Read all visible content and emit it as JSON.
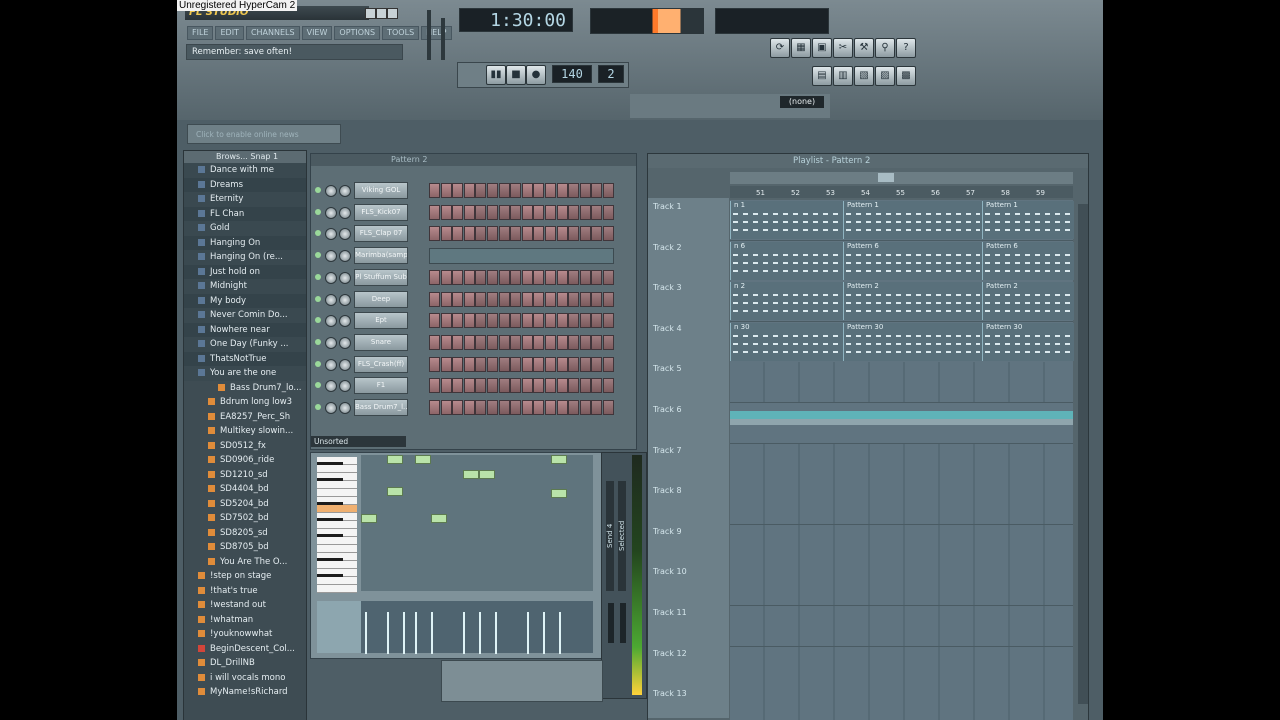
{
  "watermark": "Unregistered HyperCam 2",
  "app": {
    "logo": "FL STUDIO",
    "menu": [
      "FILE",
      "EDIT",
      "CHANNELS",
      "VIEW",
      "OPTIONS",
      "TOOLS",
      "HELP"
    ],
    "hint": "Remember: save often!",
    "time": "1:30:00",
    "tempo": "140",
    "pattern_num": "2",
    "snap_mode": "(none)",
    "online_news": "Click to enable online news"
  },
  "browser": {
    "header": "Brows... Snap 1",
    "items": [
      {
        "label": "Dance with me",
        "kind": "folder"
      },
      {
        "label": "Dreams",
        "kind": "folder"
      },
      {
        "label": "Eternity",
        "kind": "folder"
      },
      {
        "label": "FL Chan",
        "kind": "folder"
      },
      {
        "label": "Gold",
        "kind": "folder"
      },
      {
        "label": "Hanging On",
        "kind": "folder"
      },
      {
        "label": "Hanging On (re...",
        "kind": "folder"
      },
      {
        "label": "Just hold on",
        "kind": "folder"
      },
      {
        "label": "Midnight",
        "kind": "folder"
      },
      {
        "label": "My body",
        "kind": "folder"
      },
      {
        "label": "Never Comin Do...",
        "kind": "folder"
      },
      {
        "label": "Nowhere near",
        "kind": "folder"
      },
      {
        "label": "One Day (Funky ...",
        "kind": "folder"
      },
      {
        "label": "ThatsNotTrue",
        "kind": "folder"
      },
      {
        "label": "You are the one",
        "kind": "folder"
      },
      {
        "label": "Bass Drum7_lo...",
        "kind": "file-sub"
      },
      {
        "label": "Bdrum long low3",
        "kind": "file"
      },
      {
        "label": "EA8257_Perc_Sh",
        "kind": "file"
      },
      {
        "label": "Multikey slowin...",
        "kind": "file"
      },
      {
        "label": "SD0512_fx",
        "kind": "file"
      },
      {
        "label": "SD0906_ride",
        "kind": "file"
      },
      {
        "label": "SD1210_sd",
        "kind": "file"
      },
      {
        "label": "SD4404_bd",
        "kind": "file"
      },
      {
        "label": "SD5204_bd",
        "kind": "file"
      },
      {
        "label": "SD7502_bd",
        "kind": "file"
      },
      {
        "label": "SD8205_sd",
        "kind": "file"
      },
      {
        "label": "SD8705_bd",
        "kind": "file"
      },
      {
        "label": "You Are The O...",
        "kind": "file"
      },
      {
        "label": "!step on stage",
        "kind": "proj"
      },
      {
        "label": "!that's true",
        "kind": "proj"
      },
      {
        "label": "!westand out",
        "kind": "proj"
      },
      {
        "label": "!whatman",
        "kind": "proj"
      },
      {
        "label": "!youknowwhat",
        "kind": "proj"
      },
      {
        "label": "BeginDescent_Col...",
        "kind": "proj-red"
      },
      {
        "label": "DL_DrillNB",
        "kind": "proj"
      },
      {
        "label": "i will vocals mono",
        "kind": "proj"
      },
      {
        "label": "MyName!sRichard",
        "kind": "proj"
      }
    ]
  },
  "rack": {
    "title": "Pattern 2",
    "group": "Unsorted",
    "channels": [
      "Viking GOL",
      "FLS_Kick07",
      "FLS_Clap 07",
      "Marimba(sample)",
      "Pl Stuffum Sub",
      "Deep",
      "Ept",
      "Snare",
      "FLS_Crash(ff)",
      "F1",
      "Bass Drum7_l..."
    ]
  },
  "mixer": {
    "send_label": "Send 4",
    "selected_label": "Selected"
  },
  "playlist": {
    "title": "Playlist - Pattern 2",
    "ruler": [
      "51",
      "52",
      "53",
      "54",
      "55",
      "56",
      "57",
      "58",
      "59"
    ],
    "tracks": [
      {
        "label": "Track 1",
        "patterns": [
          "n 1",
          "Pattern 1",
          "Pattern 1"
        ]
      },
      {
        "label": "Track 2",
        "patterns": [
          "n 6",
          "Pattern 6",
          "Pattern 6"
        ]
      },
      {
        "label": "Track 3",
        "patterns": [
          "n 2",
          "Pattern 2",
          "Pattern 2"
        ]
      },
      {
        "label": "Track 4",
        "patterns": [
          "n 30",
          "Pattern 30",
          "Pattern 30"
        ]
      },
      {
        "label": "Track 5",
        "patterns": []
      },
      {
        "label": "Track 6",
        "patterns": []
      },
      {
        "label": "Track 7",
        "patterns": []
      },
      {
        "label": "Track 8",
        "patterns": []
      },
      {
        "label": "Track 9",
        "patterns": []
      },
      {
        "label": "Track 10",
        "patterns": []
      },
      {
        "label": "Track 11",
        "patterns": []
      },
      {
        "label": "Track 12",
        "patterns": []
      },
      {
        "label": "Track 13",
        "patterns": []
      }
    ]
  },
  "colors": {
    "app_bg": "#4e5e66",
    "step_button": "#a8797c",
    "note": "#b9e3a9",
    "playlist_lane": "#607480",
    "logo": "#f0c850"
  }
}
